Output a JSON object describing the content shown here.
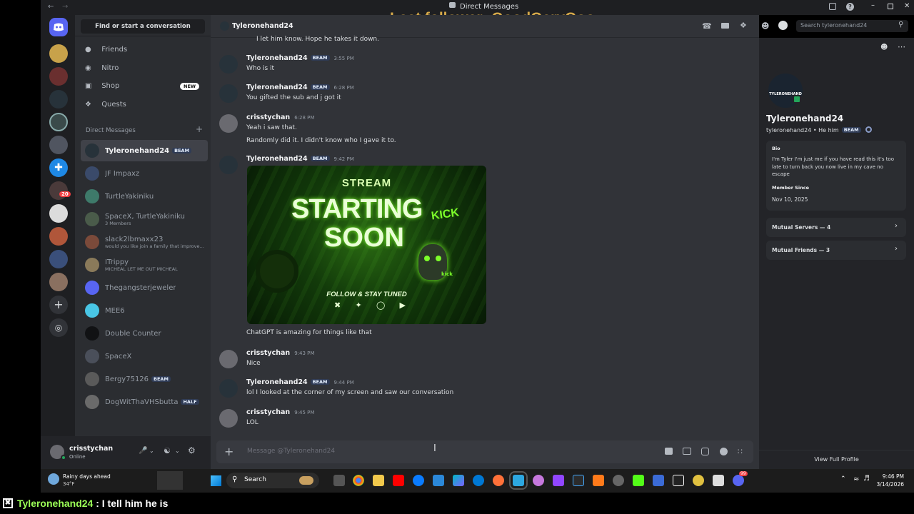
{
  "window": {
    "title": "Direct Messages"
  },
  "stream_overlay": {
    "text": "Last follower: GoodGaryGoo"
  },
  "chat_overlay": {
    "username": "Tyleronehand24",
    "message": " : I tell him he is"
  },
  "dm_column": {
    "search_label": "Find or start a conversation",
    "nav": [
      {
        "label": "Friends"
      },
      {
        "label": "Nitro"
      },
      {
        "label": "Shop",
        "badge": "NEW"
      },
      {
        "label": "Quests"
      }
    ],
    "section_title": "Direct Messages",
    "dms": [
      {
        "name": "Tyleronehand24",
        "badge": "BEAM",
        "sub": "",
        "color": "#27323a"
      },
      {
        "name": "JF Impaxz",
        "badge": "",
        "sub": "",
        "color": "#3a4a6a"
      },
      {
        "name": "TurtleYakiniku",
        "badge": "",
        "sub": "",
        "color": "#3e7a6a"
      },
      {
        "name": "SpaceX, TurtleYakiniku",
        "badge": "",
        "sub": "3 Members",
        "color": "#4a5b4a"
      },
      {
        "name": "slack2lbmaxx23",
        "badge": "",
        "sub": "would you like join a family that improves...",
        "color": "#7b4a3a"
      },
      {
        "name": "ITrippy",
        "badge": "",
        "sub": "MICHEAL LET ME OUT MICHEAL",
        "color": "#8a7a5a"
      },
      {
        "name": "Thegangsterjeweler",
        "badge": "",
        "sub": "",
        "color": "#5865f2"
      },
      {
        "name": "MEE6",
        "badge": "",
        "sub": "",
        "color": "#49c6e5"
      },
      {
        "name": "Double Counter",
        "badge": "",
        "sub": "",
        "color": "#111214"
      },
      {
        "name": "SpaceX",
        "badge": "",
        "sub": "",
        "color": "#4a4f5a"
      },
      {
        "name": "Bergy75126",
        "badge": "BEAM",
        "sub": "",
        "color": "#5a5a5a"
      },
      {
        "name": "DogWitThaVHSbutta",
        "badge": "HALF",
        "sub": "",
        "color": "#6a6a6a"
      }
    ],
    "user": {
      "name": "crisstychan",
      "status": "Online"
    }
  },
  "chat": {
    "header": {
      "name": "Tyleronehand24",
      "search_placeholder": "Search tyleronehand24"
    },
    "partial_top": "I let him know. Hope he takes it down.",
    "messages": [
      {
        "author": "Tyleronehand24",
        "badge": "BEAM",
        "time": "3:55 PM",
        "lines": [
          "Who is it"
        ]
      },
      {
        "author": "Tyleronehand24",
        "badge": "BEAM",
        "time": "6:28 PM",
        "lines": [
          "You gifted the sub and j got it"
        ]
      },
      {
        "author": "crisstychan",
        "badge": "",
        "time": "6:28 PM",
        "lines": [
          "Yeah i saw that.",
          "Randomly did it. I didn't know who I gave it to."
        ]
      },
      {
        "author": "Tyleronehand24",
        "badge": "BEAM",
        "time": "9:42 PM",
        "lines": [
          "ChatGPT is amazing for things like that"
        ]
      },
      {
        "author": "crisstychan",
        "badge": "",
        "time": "9:43 PM",
        "lines": [
          "Nice"
        ]
      },
      {
        "author": "Tyleronehand24",
        "badge": "BEAM",
        "time": "9:44 PM",
        "lines": [
          "lol I looked at the corner of my screen and saw our conversation"
        ]
      },
      {
        "author": "crisstychan",
        "badge": "",
        "time": "9:45 PM",
        "lines": [
          "LOL"
        ]
      }
    ],
    "image": {
      "line1": "STREAM",
      "line2": "STARTING",
      "line3": "SOON",
      "tag": "KICK",
      "footer": "FOLLOW & STAY TUNED",
      "mini": "kick"
    },
    "composer_placeholder": "Message @Tyleronehand24"
  },
  "profile": {
    "avatar_text": "TYLERONEHAND",
    "display_name": "Tyleronehand24",
    "username_line": "tyleronehand24 • He him",
    "badge": "BEAM",
    "bio_title": "Bio",
    "bio": "I'm Tyler I'm just me if you have read this  it's too late to turn back you now live in my cave no escape",
    "member_since_title": "Member Since",
    "member_since": "Nov 10, 2025",
    "mutual_servers": "Mutual Servers — 4",
    "mutual_friends": "Mutual Friends — 3",
    "view_full": "View Full Profile"
  },
  "guild_badge": "20",
  "taskbar": {
    "weather_title": "Rainy days ahead",
    "weather_temp": "34°F",
    "search": "Search",
    "time": "9:46 PM",
    "date": "3/14/2026",
    "notif": "99"
  },
  "colors": {
    "accent": "#5865f2",
    "bg": "#313338",
    "sidebar": "#2b2d31",
    "guilds": "#1e1f22",
    "overlay": "#d4a84a",
    "beam": "#2f3b55"
  }
}
